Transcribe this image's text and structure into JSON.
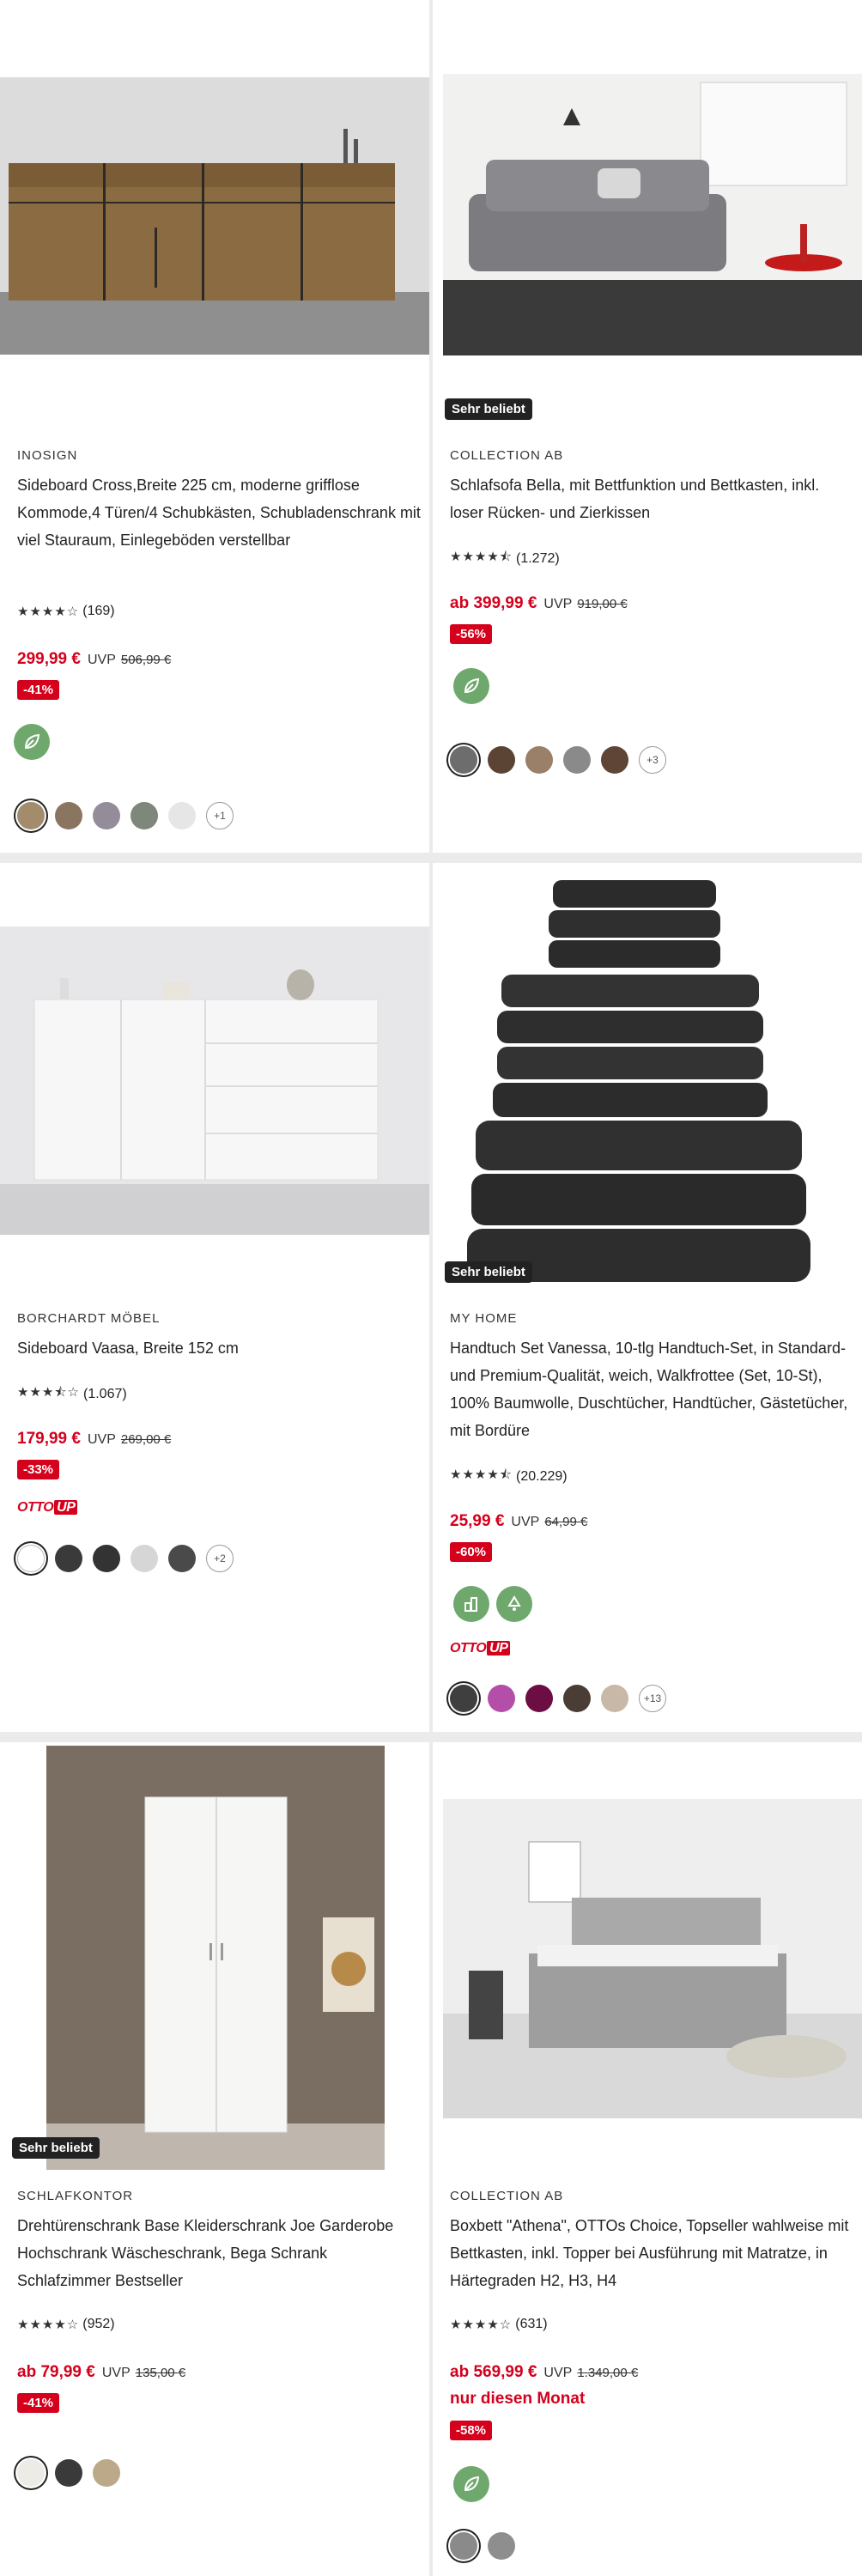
{
  "products": [
    {
      "brand": "INOSIGN",
      "title": "Sideboard Cross,Breite 225 cm, moderne grifflose Kommode,4 Türen/4 Schubkästen, Schubladenschrank mit viel Stauraum, Einlegeböden verstellbar",
      "stars": "★★★★☆",
      "reviews": "(169)",
      "price": "299,99 €",
      "uvp_label": "UVP",
      "old_price": "506,99 €",
      "discount": "-41%",
      "swatches": [
        "#a38c6c",
        "#8a7660",
        "#958c9a",
        "#7f877a",
        "#e6e6e6"
      ],
      "more": "+1"
    },
    {
      "badge": "Sehr beliebt",
      "brand": "COLLECTION AB",
      "title": "Schlafsofa Bella, mit Bettfunktion und Bettkasten, inkl. loser Rücken- und Zierkissen",
      "stars": "★★★★⯪",
      "reviews": "(1.272)",
      "price": "ab 399,99 €",
      "uvp_label": "UVP",
      "old_price": "919,00 €",
      "discount": "-56%",
      "swatches": [
        "#6d6d6d",
        "#5b4434",
        "#9a8068",
        "#8a8a8a",
        "#5e4535"
      ],
      "more": "+3"
    },
    {
      "brand": "BORCHARDT MÖBEL",
      "title": "Sideboard Vaasa, Breite 152 cm",
      "stars": "★★★⯪☆",
      "reviews": "(1.067)",
      "price": "179,99 €",
      "uvp_label": "UVP",
      "old_price": "269,00 €",
      "discount": "-33%",
      "otto": "OTTO",
      "otto_up": "UP",
      "swatches": [
        "#ffffff",
        "#3a3a3a",
        "#333333",
        "#d6d6d6",
        "#4a4a4a"
      ],
      "more": "+2"
    },
    {
      "badge": "Sehr beliebt",
      "brand": "MY HOME",
      "title": "Handtuch Set Vanessa, 10-tlg Handtuch-Set, in Standard- und Premium-Qualität, weich, Walkfrottee (Set, 10-St), 100% Baumwolle, Duschtücher, Handtücher, Gästetücher, mit Bordüre",
      "stars": "★★★★⯪",
      "reviews": "(20.229)",
      "price": "25,99 €",
      "uvp_label": "UVP",
      "old_price": "64,99 €",
      "discount": "-60%",
      "otto": "OTTO",
      "otto_up": "UP",
      "swatches": [
        "#3f3f3f",
        "#b34fa8",
        "#6c0d44",
        "#4a3d35",
        "#c8b8a8"
      ],
      "more": "+13"
    },
    {
      "badge": "Sehr beliebt",
      "brand": "SCHLAFKONTOR",
      "title": "Drehtürenschrank Base Kleiderschrank Joe Garderobe Hochschrank Wäscheschrank, Bega Schrank Schlafzimmer Bestseller",
      "stars": "★★★★☆",
      "reviews": "(952)",
      "price": "ab 79,99 €",
      "uvp_label": "UVP",
      "old_price": "135,00 €",
      "discount": "-41%",
      "swatches": [
        "#ecebe6",
        "#3a3a3a",
        "#bba98a"
      ]
    },
    {
      "brand": "COLLECTION AB",
      "title": "Boxbett \"Athena\", OTTOs Choice, Topseller wahlweise mit Bettkasten, inkl. Topper bei Ausführung mit Matratze, in Härtegraden H2, H3, H4",
      "stars": "★★★★☆",
      "reviews": "(631)",
      "price": "ab 569,99 €",
      "uvp_label": "UVP",
      "old_price": "1.349,00 €",
      "extra": "nur diesen Monat",
      "discount": "-58%",
      "swatches": [
        "#8a8a8a",
        "#8e8e8e"
      ]
    }
  ],
  "icons": {
    "eco": "leaf-icon",
    "eco2": "recycle-icon"
  },
  "colors": {
    "price_red": "#d4001c",
    "eco_green": "#6fa86d"
  }
}
